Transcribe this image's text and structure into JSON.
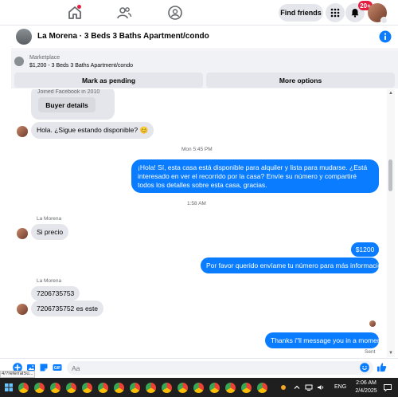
{
  "topnav": {
    "find_friends_label": "Find friends",
    "notifications_badge": "20+",
    "icons": [
      "home-icon",
      "friends-icon",
      "groups-icon",
      "menu-grid-icon",
      "bell-icon"
    ]
  },
  "chat": {
    "title": "La Morena · 3 Beds 3 Baths Apartment/condo"
  },
  "marketplace": {
    "label": "Marketplace",
    "detail": "$1,200 - 3 Beds 3 Baths Apartment/condo",
    "pending_button": "Mark as pending",
    "more_button": "More options"
  },
  "profile_card": {
    "joined": "Joined Facebook in 2010",
    "buyer_details_button": "Buyer details"
  },
  "messages": [
    {
      "id": "m1",
      "direction": "in",
      "text": "Hola. ¿Sigue estando disponible? 😊"
    },
    {
      "id": "ts1",
      "type": "timestamp",
      "text": "Mon 5:45 PM"
    },
    {
      "id": "m2",
      "direction": "out",
      "text": "¡Hola! Sí, esta casa está disponible para alquiler y lista para mudarse. ¿Está interesado en ver el recorrido por la casa? Envíe su número y compartiré todos los detalles sobre esta casa, gracias."
    },
    {
      "id": "ts2",
      "type": "timestamp",
      "text": "1:58 AM"
    },
    {
      "id": "s1",
      "type": "sender",
      "text": "La Morena"
    },
    {
      "id": "m3",
      "direction": "in",
      "text": "Si precio"
    },
    {
      "id": "m4",
      "direction": "out",
      "text": "$1200"
    },
    {
      "id": "m5",
      "direction": "out",
      "text": "Por favor querido envíame tu número para más información."
    },
    {
      "id": "s2",
      "type": "sender",
      "text": "La Morena"
    },
    {
      "id": "m6",
      "direction": "in",
      "text": "7206735753"
    },
    {
      "id": "m7",
      "direction": "in",
      "text": "7206735752 es este"
    },
    {
      "id": "m8",
      "direction": "out",
      "text": "Thanks i\"ll message you in a moment"
    },
    {
      "id": "sent",
      "type": "status",
      "text": "Sent"
    }
  ],
  "composer": {
    "placeholder": "Aa",
    "url_tooltip": "4/?referralSu..."
  },
  "taskbar": {
    "language": "ENG",
    "time": "2:06 AM",
    "date": "2/4/2025"
  },
  "colors": {
    "outgoing_bubble": "#0a7cff",
    "incoming_bubble": "#e4e6eb",
    "notification_red": "#e41e3f",
    "taskbar": "#1f1f1f"
  }
}
